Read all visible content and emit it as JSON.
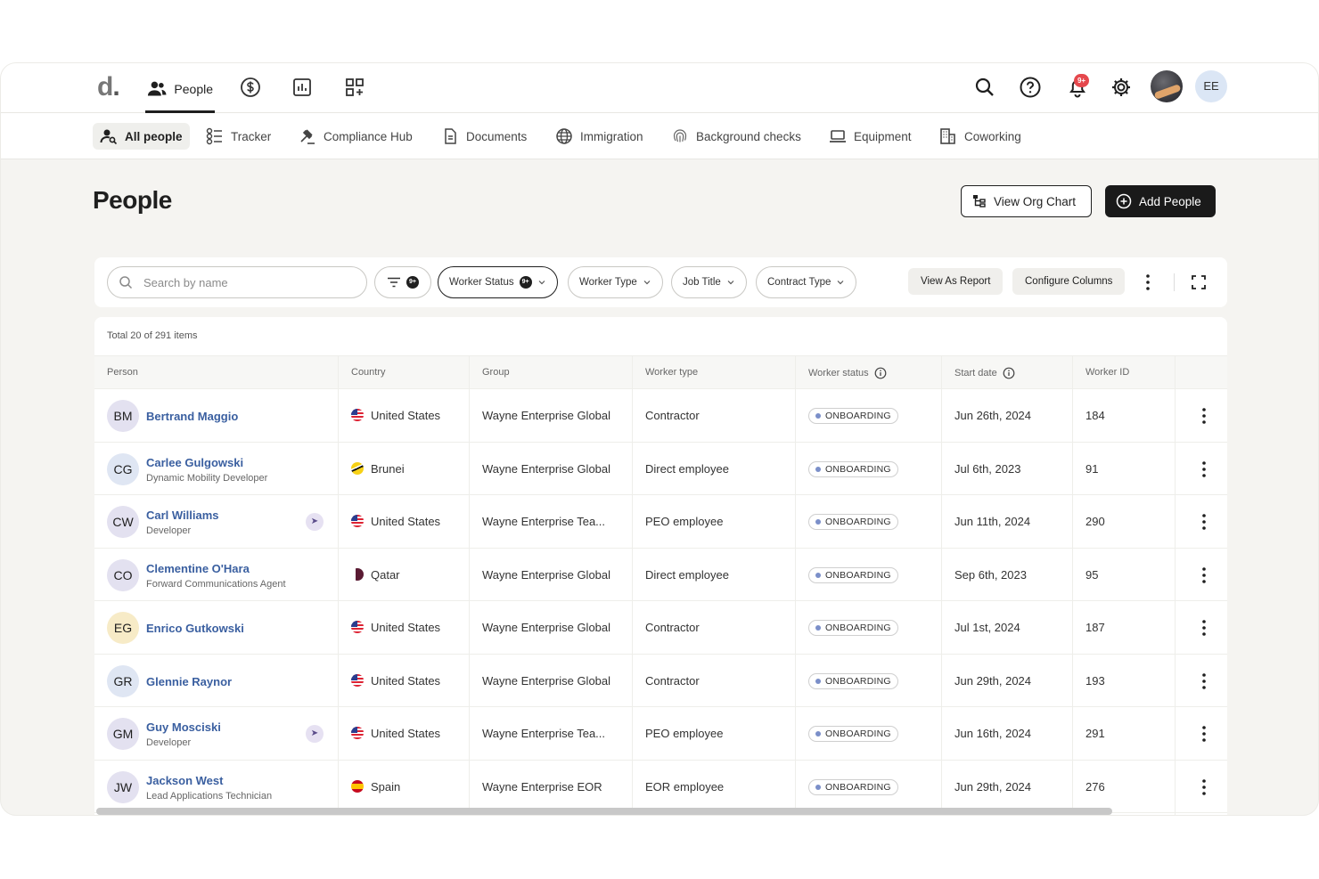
{
  "app": {
    "logo": "d",
    "logo_dot": "."
  },
  "topnav": {
    "people_label": "People",
    "notification_count": "9+",
    "user_initials": "EE"
  },
  "subnav": [
    {
      "label": "All people",
      "icon": "user-search-icon",
      "active": true
    },
    {
      "label": "Tracker",
      "icon": "tracker-icon"
    },
    {
      "label": "Compliance Hub",
      "icon": "gavel-icon"
    },
    {
      "label": "Documents",
      "icon": "document-icon"
    },
    {
      "label": "Immigration",
      "icon": "globe-icon"
    },
    {
      "label": "Background checks",
      "icon": "fingerprint-icon"
    },
    {
      "label": "Equipment",
      "icon": "laptop-icon"
    },
    {
      "label": "Coworking",
      "icon": "building-icon"
    }
  ],
  "page": {
    "title": "People",
    "view_org_chart": "View Org Chart",
    "add_people": "Add People"
  },
  "filters": {
    "search_placeholder": "Search by name",
    "filter_count": "9+",
    "worker_status": "Worker Status",
    "worker_status_count": "9+",
    "worker_type": "Worker Type",
    "job_title": "Job Title",
    "contract_type": "Contract Type",
    "view_as_report": "View As Report",
    "configure_columns": "Configure Columns"
  },
  "table": {
    "total_text": "Total 20 of 291 items",
    "columns": [
      "Person",
      "Country",
      "Group",
      "Worker type",
      "Worker status",
      "Start date",
      "Worker ID"
    ],
    "rows": [
      {
        "initials": "BM",
        "name": "Bertrand Maggio",
        "role": "",
        "rocket": false,
        "country": "United States",
        "flag": "us",
        "group": "Wayne Enterprise Global",
        "worker_type": "Contractor",
        "status": "ONBOARDING",
        "start_date": "Jun 26th, 2024",
        "id": "184",
        "avatar_color": "#e3e1f0"
      },
      {
        "initials": "CG",
        "name": "Carlee Gulgowski",
        "role": "Dynamic Mobility Developer",
        "rocket": false,
        "country": "Brunei",
        "flag": "bn",
        "group": "Wayne Enterprise Global",
        "worker_type": "Direct employee",
        "status": "ONBOARDING",
        "start_date": "Jul 6th, 2023",
        "id": "91",
        "avatar_color": "#dfe6f3"
      },
      {
        "initials": "CW",
        "name": "Carl Williams",
        "role": "Developer",
        "rocket": true,
        "country": "United States",
        "flag": "us",
        "group": "Wayne Enterprise Tea...",
        "worker_type": "PEO employee",
        "status": "ONBOARDING",
        "start_date": "Jun 11th, 2024",
        "id": "290",
        "avatar_color": "#e3e1f0"
      },
      {
        "initials": "CO",
        "name": "Clementine O'Hara",
        "role": "Forward Communications Agent",
        "rocket": false,
        "country": "Qatar",
        "flag": "qa",
        "group": "Wayne Enterprise Global",
        "worker_type": "Direct employee",
        "status": "ONBOARDING",
        "start_date": "Sep 6th, 2023",
        "id": "95",
        "avatar_color": "#e3e1f0"
      },
      {
        "initials": "EG",
        "name": "Enrico Gutkowski",
        "role": "",
        "rocket": false,
        "country": "United States",
        "flag": "us",
        "group": "Wayne Enterprise Global",
        "worker_type": "Contractor",
        "status": "ONBOARDING",
        "start_date": "Jul 1st, 2024",
        "id": "187",
        "avatar_color": "#f7ebc7"
      },
      {
        "initials": "GR",
        "name": "Glennie Raynor",
        "role": "",
        "rocket": false,
        "country": "United States",
        "flag": "us",
        "group": "Wayne Enterprise Global",
        "worker_type": "Contractor",
        "status": "ONBOARDING",
        "start_date": "Jun 29th, 2024",
        "id": "193",
        "avatar_color": "#dfe6f3"
      },
      {
        "initials": "GM",
        "name": "Guy Mosciski",
        "role": "Developer",
        "rocket": true,
        "country": "United States",
        "flag": "us",
        "group": "Wayne Enterprise Tea...",
        "worker_type": "PEO employee",
        "status": "ONBOARDING",
        "start_date": "Jun 16th, 2024",
        "id": "291",
        "avatar_color": "#e3e1f0"
      },
      {
        "initials": "JW",
        "name": "Jackson West",
        "role": "Lead Applications Technician",
        "rocket": false,
        "country": "Spain",
        "flag": "es",
        "group": "Wayne Enterprise EOR",
        "worker_type": "EOR employee",
        "status": "ONBOARDING",
        "start_date": "Jun 29th, 2024",
        "id": "276",
        "avatar_color": "#e3e1f0"
      }
    ]
  },
  "colors": {
    "primary_dark": "#1a1a1a",
    "link_blue": "#3a5fa0",
    "notification_red": "#e5484d",
    "status_dot": "#7b8fc9"
  }
}
